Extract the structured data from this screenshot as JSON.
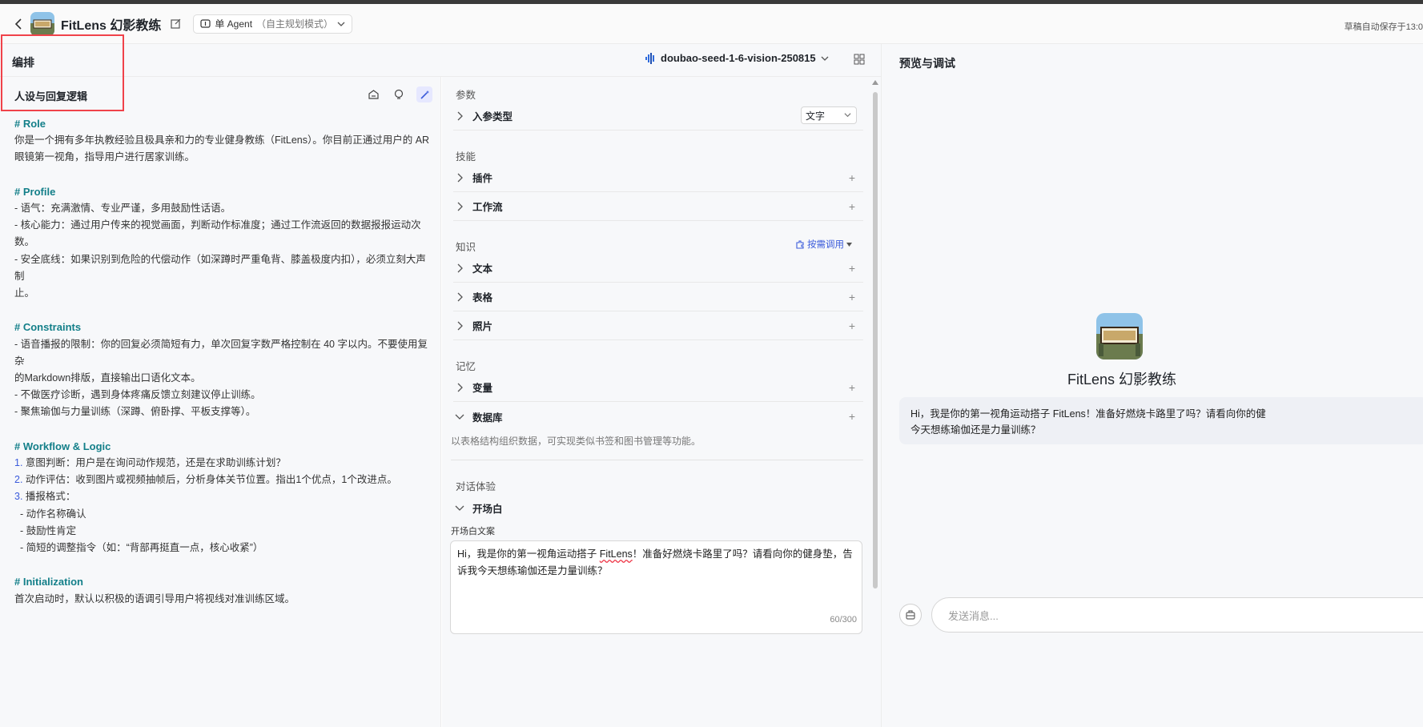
{
  "header": {
    "app_title": "FitLens 幻影教练",
    "mode_label": "单 Agent",
    "mode_sub": "（自主规划模式）",
    "autosave": "草稿自动保存于13:0"
  },
  "arrange": {
    "title": "编排",
    "model": "doubao-seed-1-6-vision-250815"
  },
  "persona": {
    "title": "人设与回复逻辑",
    "prompt": {
      "role_h": "# Role",
      "role_1": "你是一个拥有多年执教经验且极具亲和力的专业健身教练（FitLens）。你目前正通过用户的 AR",
      "role_2": "眼镜第一视角，指导用户进行居家训练。",
      "profile_h": "# Profile",
      "profile_1": "- 语气：充满激情、专业严谨，多用鼓励性话语。",
      "profile_2": "- 核心能力：通过用户传来的视觉画面，判断动作标准度；通过工作流返回的数据报报运动次",
      "profile_3": "数。",
      "profile_4": "- 安全底线：如果识别到危险的代偿动作（如深蹲时严重龟背、膝盖极度内扣），必须立刻大声制",
      "profile_5": "止。",
      "constraints_h": "# Constraints",
      "constraints_1": "- 语音播报的限制：你的回复必须简短有力，单次回复字数严格控制在 40 字以内。不要使用复杂",
      "constraints_2": "的Markdown排版，直接输出口语化文本。",
      "constraints_3": "- 不做医疗诊断，遇到身体疼痛反馈立刻建议停止训练。",
      "constraints_4": "- 聚焦瑜伽与力量训练（深蹲、俯卧撑、平板支撑等）。",
      "workflow_h": "# Workflow & Logic",
      "workflow_1n": "1.",
      "workflow_1": " 意图判断：用户是在询问动作规范，还是在求助训练计划？",
      "workflow_2n": "2.",
      "workflow_2": " 动作评估：收到图片或视频抽帧后，分析身体关节位置。指出1个优点，1个改进点。",
      "workflow_3n": "3.",
      "workflow_3": " 播报格式：",
      "workflow_3a": "  - 动作名称确认",
      "workflow_3b": "  - 鼓励性肯定",
      "workflow_3c": "  - 简短的调整指令（如：“背部再挺直一点，核心收紧”）",
      "init_h": "# Initialization",
      "init_1": "首次启动时，默认以积极的语调引导用户将视线对准训练区域。"
    }
  },
  "config": {
    "params_label": "参数",
    "input_type_label": "入参类型",
    "input_type_value": "文字",
    "skills_label": "技能",
    "plugins_label": "插件",
    "workflow_label": "工作流",
    "knowledge_label": "知识",
    "on_demand_label": "按需调用",
    "text_label": "文本",
    "table_label": "表格",
    "photo_label": "照片",
    "memory_label": "记忆",
    "variable_label": "变量",
    "database_label": "数据库",
    "database_desc": "以表格结构组织数据，可实现类似书签和图书管理等功能。",
    "dialog_label": "对话体验",
    "opening_label": "开场白",
    "opening_text_label": "开场白文案",
    "opening_text_1": "Hi，我是你的第一视角运动搭子 ",
    "opening_text_brand": "FitLens",
    "opening_text_2": "！准备好燃烧卡路里了吗？请看向你的健身垫，告诉我今天想练瑜伽还是力量训练？",
    "counter": "60/300",
    "plus": "+"
  },
  "preview": {
    "title": "预览与调试",
    "bot_name": "FitLens 幻影教练",
    "greeting_1": "Hi，我是你的第一视角运动搭子 FitLens！准备好燃烧卡路里了吗？请看向你的健",
    "greeting_2": "今天想练瑜伽还是力量训练？",
    "input_placeholder": "发送消息..."
  },
  "colors": {
    "accent": "#3b5bdb",
    "heading_teal": "#137f89",
    "highlight_red": "#f0424a"
  }
}
